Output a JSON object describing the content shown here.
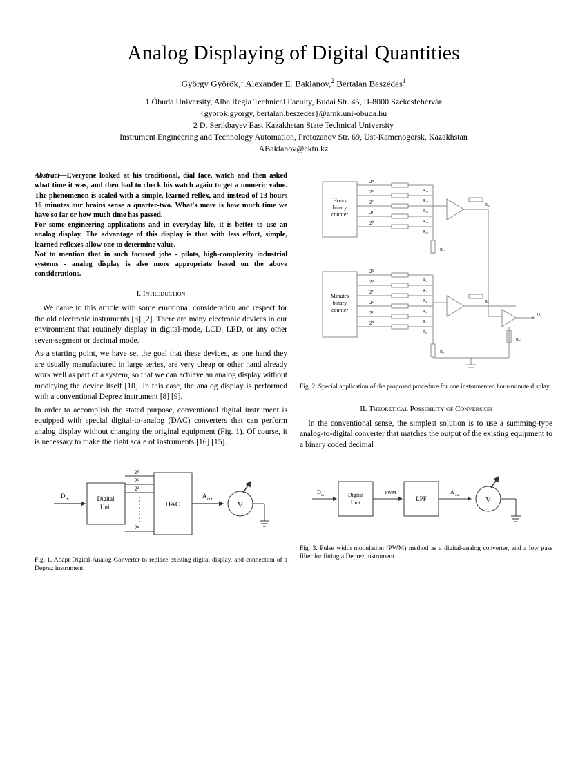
{
  "title": "Analog Displaying of Digital Quantities",
  "authors_html": "György Györök,¹ Alexander E. Baklanov,² Bertalan Beszédes¹",
  "affil_lines": [
    "1 Óbuda University, Alba Regia Technical Faculty, Budai Str. 45, H-8000 Székesfehérvár",
    "{gyorok.gyorgy, bertalan.beszedes}@amk.uni-obuda.hu",
    "2 D. Serikbayev East Kazakhstan State Technical University",
    "Instrument Engineering and Technology Automation, Protozanov Str. 69, Ust-Kamenogorsk, Kazakhstan",
    "ABaklanov@ektu.kz"
  ],
  "abstract_label": "Abstract—",
  "abstract_body": "Everyone looked at his traditional, dial face, watch and then asked what time it was, and then had to check his watch again to get a numeric value. The phenomenon is scaled with a simple, learned reflex, and instead of 13 hours 16 minutes our brains sense a quarter-two. What's more is how much time we have so far or how much time has passed.\nFor some engineering applications and in everyday life, it is better to use an analog display. The advantage of this display is that with less effort, simple, learned reflexes allow one to determine value.\nNot to mention that in such focused jobs - pilots, high-complexity industrial systems - analog display is also more appropriate based on the above considerations.",
  "sec1_heading": "I.  Introduction",
  "sec1_p1": "We came to this article with some emotional consideration and respect for the old electronic instruments [3] [2]. There are many electronic devices in our environment that routinely display in digital-mode, LCD, LED, or any other seven-segment or decimal mode.",
  "sec1_p2": "As a starting point, we have set the goal that these devices, as one hand they are usually manufactured in large series, are very cheap or other hand already work well as part of a system, so that we can achieve an analog display without modifying the device itself [10]. In this case, the analog display is performed with a conventional Deprez instrument [8] [9].",
  "sec1_p3": "In order to accomplish the stated purpose, conventional digital instrument is equipped with special digital-to-analog (DAC) converters that can perform analog display without changing the original equipment (Fig. 1). Of course, it is necessary to make the right scale of instruments [16] [15].",
  "sec2_heading": "II.  Theoretical Possibility of Conversion",
  "sec2_p1": "In the conventional sense, the simplest solution is to use a summing-type analog-to-digital converter that matches the output of the existing equipment to a binary coded decimal",
  "fig1_caption": "Fig. 1.   Adapt Digital-Analog Converter to replace existing digital display, and connection of a Deprez instrument.",
  "fig2_caption": "Fig. 2.   Special application of the proposed procedure for one instrumented hour-minute display.",
  "fig3_caption": "Fig. 3.   Pulse width modulation (PWM) method as a digital-analog converter, and a low pass filter for fitting a Deprez instrument.",
  "fig1": {
    "din": "D",
    "din_sub": "in",
    "digital_unit": "Digital\nUnit",
    "dac": "DAC",
    "aout": "A",
    "aout_sub": "out",
    "v": "V",
    "bits": [
      "2⁰",
      "2¹",
      "2²",
      "2ⁿ"
    ]
  },
  "fig2": {
    "hours_label": "Hours\nbinary\ncounter",
    "minutes_label": "Minutes\nbinary\ncounter",
    "hours_bits": [
      "2⁴",
      "2³",
      "2²",
      "2¹",
      "2⁰"
    ],
    "minutes_bits": [
      "2⁵",
      "2⁴",
      "2³",
      "2²",
      "2¹",
      "2⁰"
    ],
    "r_hours": [
      "R₁₄",
      "R₁₃",
      "R₁₂",
      "R₁₁",
      "R₁₀"
    ],
    "r_minutes": [
      "R₅",
      "R₄",
      "R₃",
      "R₂",
      "R₁",
      "R₀"
    ],
    "r_extra": [
      "R₁₈",
      "R₁₅",
      "R₆",
      "R₇",
      "R₂₀"
    ],
    "uo": "Uₒ"
  },
  "fig3": {
    "din": "D",
    "din_sub": "in",
    "digital_unit": "Digital\nUnit",
    "pwm": "PWM",
    "lpf": "LPF",
    "aout": "A",
    "aout_sub": "out",
    "v": "V"
  }
}
